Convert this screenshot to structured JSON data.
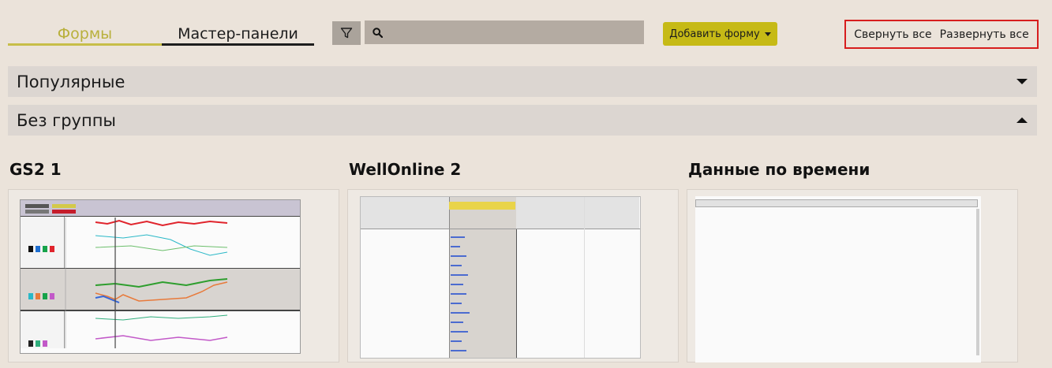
{
  "tabs": [
    {
      "label": "Формы",
      "active": true
    },
    {
      "label": "Мастер-панели",
      "active": false
    }
  ],
  "toolbar": {
    "filter_icon": "funnel-icon",
    "search_icon": "magnifier-icon",
    "search_value": "",
    "add_form_label": "Добавить форму",
    "collapse_all": "Свернуть все",
    "expand_all": "Развернуть все"
  },
  "groups": [
    {
      "label": "Популярные",
      "state": "collapsed"
    },
    {
      "label": "Без группы",
      "state": "expanded"
    }
  ],
  "cards": [
    {
      "title": "GS2 1"
    },
    {
      "title": "WellOnline 2"
    },
    {
      "title": "Данные по времени"
    }
  ],
  "colors": {
    "accent": "#c6ba16",
    "active_tab": "#b9b03c",
    "highlight_border": "#d71d1d"
  }
}
